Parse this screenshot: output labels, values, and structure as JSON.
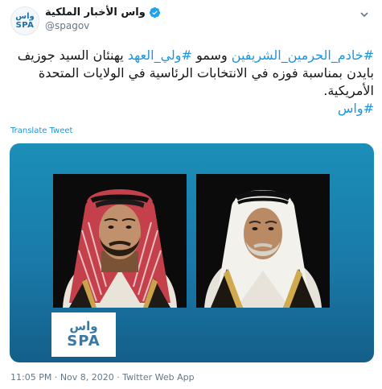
{
  "account": {
    "display_name": "واس الأخبار الملكية",
    "handle": "@spagov",
    "avatar_ar": "واس",
    "avatar_en": "SPA",
    "verified_icon": "verified-badge-icon"
  },
  "tweet": {
    "segment_1": "#خادم_الحرمين_الشريفين",
    "segment_2": " وسمو ",
    "segment_3": "#ولي_العهد",
    "segment_4": " يهنئان السيد جوزيف بايدن بمناسبة فوزه في الانتخابات الرئاسية في الولايات المتحدة الأمريكية.",
    "segment_5": "#واس"
  },
  "translate_label": "Translate Tweet",
  "media": {
    "logo_ar": "واس",
    "logo_en": "SPA"
  },
  "meta": {
    "time": "11:05 PM",
    "sep1": " · ",
    "date": "Nov 8, 2020",
    "sep2": " · ",
    "source": "Twitter Web App"
  },
  "colors": {
    "link": "#1b95e0",
    "verified": "#1da1f2",
    "media_background": "#1a79a8",
    "logo": "#3a78a6"
  }
}
